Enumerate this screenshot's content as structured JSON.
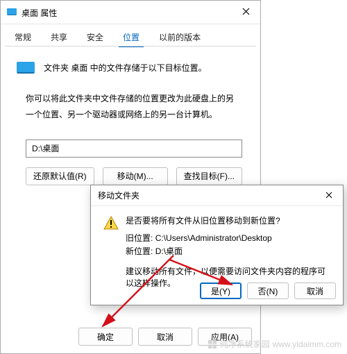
{
  "window": {
    "title": "桌面 属性",
    "close_icon_name": "close-icon"
  },
  "tabs": {
    "items": [
      {
        "label": "常规"
      },
      {
        "label": "共享"
      },
      {
        "label": "安全"
      },
      {
        "label": "位置",
        "active": true
      },
      {
        "label": "以前的版本"
      }
    ]
  },
  "location_tab": {
    "header_text": "文件夹 桌面 中的文件存储于以下目标位置。",
    "help_text": "你可以将此文件夹中文件存储的位置更改为此硬盘上的另一个位置、另一个驱动器或网络上的另一台计算机。",
    "path_value": "D:\\桌面",
    "buttons": {
      "restore": "还原默认值(R)",
      "move": "移动(M)...",
      "find": "查找目标(F)..."
    }
  },
  "footer": {
    "ok": "确定",
    "cancel": "取消",
    "apply": "应用(A)"
  },
  "dialog": {
    "title": "移动文件夹",
    "question": "是否要将所有文件从旧位置移动到新位置?",
    "old_label": "旧位置:",
    "old_value": "C:\\Users\\Administrator\\Desktop",
    "new_label": "新位置:",
    "new_value": "D:\\桌面",
    "hint": "建议移动所有文件，以便需要访问文件夹内容的程序可以这样操作。",
    "yes": "是(Y)",
    "no": "否(N)",
    "cancel": "取消"
  },
  "watermark": {
    "brand": "纯净系统家园",
    "url": "www.yidaimm.com"
  },
  "colors": {
    "accent": "#0067c0",
    "arrow": "#d40f18"
  }
}
